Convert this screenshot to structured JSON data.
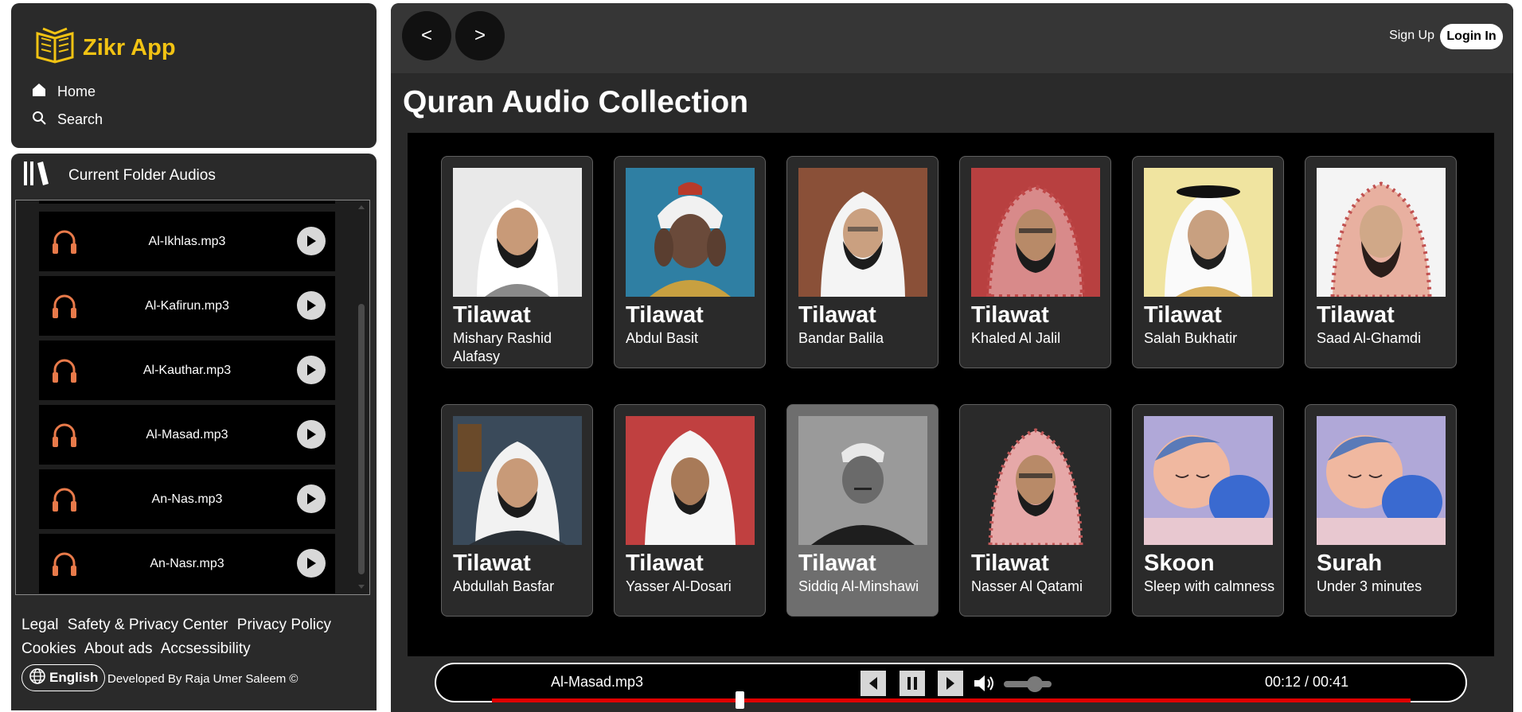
{
  "app": {
    "name": "Zikr App",
    "logo_icon": "quran-book-icon",
    "brand_color": "#f2c313"
  },
  "nav": [
    {
      "label": "Home",
      "icon": "home-icon"
    },
    {
      "label": "Search",
      "icon": "search-icon"
    }
  ],
  "folder": {
    "title": "Current Folder Audios",
    "icon": "library-icon",
    "items": [
      {
        "name": "Al-Ikhlas.mp3"
      },
      {
        "name": "Al-Kafirun.mp3"
      },
      {
        "name": "Al-Kauthar.mp3"
      },
      {
        "name": "Al-Masad.mp3"
      },
      {
        "name": "An-Nas.mp3"
      },
      {
        "name": "An-Nasr.mp3"
      }
    ]
  },
  "footer": {
    "links": [
      "Legal",
      "Safety & Privacy Center",
      "Privacy Policy",
      "Cookies",
      "About ads",
      "Accsessibility"
    ],
    "language": "English",
    "credit": "Developed By Raja Umer Saleem ©"
  },
  "header": {
    "back": "<",
    "forward": ">",
    "signup": "Sign Up",
    "login": "Login In"
  },
  "main": {
    "title": "Quran Audio Collection"
  },
  "cards": [
    {
      "title": "Tilawat",
      "subtitle": "Mishary Rashid Alafasy"
    },
    {
      "title": "Tilawat",
      "subtitle": "Abdul Basit"
    },
    {
      "title": "Tilawat",
      "subtitle": "Bandar Balila"
    },
    {
      "title": "Tilawat",
      "subtitle": "Khaled Al Jalil"
    },
    {
      "title": "Tilawat",
      "subtitle": "Salah Bukhatir"
    },
    {
      "title": "Tilawat",
      "subtitle": "Saad Al-Ghamdi"
    },
    {
      "title": "Tilawat",
      "subtitle": "Abdullah Basfar"
    },
    {
      "title": "Tilawat",
      "subtitle": "Yasser Al-Dosari"
    },
    {
      "title": "Tilawat",
      "subtitle": "Siddiq Al-Minshawi"
    },
    {
      "title": "Tilawat",
      "subtitle": "Nasser Al Qatami"
    },
    {
      "title": "Skoon",
      "subtitle": "Sleep with calmness"
    },
    {
      "title": "Surah",
      "subtitle": "Under 3 minutes"
    }
  ],
  "player": {
    "track": "Al-Masad.mp3",
    "time": "00:12 / 00:41",
    "progress_fraction": 0.27,
    "volume_fraction": 0.65,
    "progress_color": "#e00000"
  }
}
